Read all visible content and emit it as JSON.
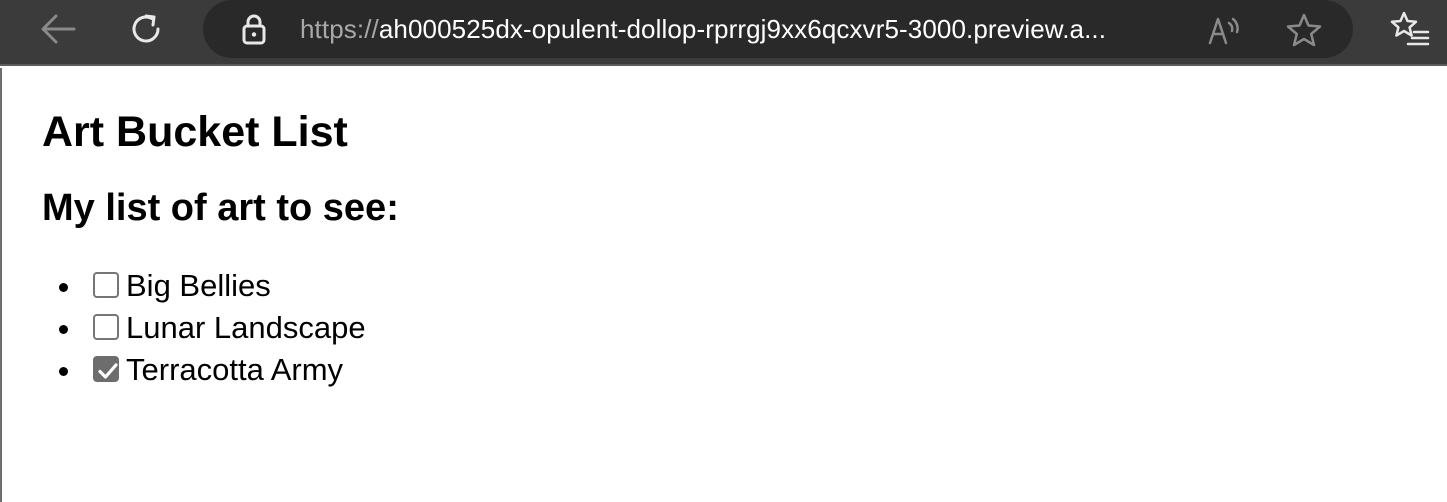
{
  "browser": {
    "url_protocol": "https://",
    "url_rest": "ah000525dx-opulent-dollop-rprrgj9xx6qcxvr5-3000.preview.a...",
    "icons": {
      "back": "arrow-left-icon",
      "reload": "reload-icon",
      "lock": "lock-icon",
      "read_aloud": "read-aloud-icon",
      "favorite": "star-icon",
      "favorites": "favorites-list-icon"
    }
  },
  "page": {
    "title": "Art Bucket List",
    "subtitle": "My list of art to see:",
    "items": [
      {
        "label": "Big Bellies",
        "checked": false
      },
      {
        "label": "Lunar Landscape",
        "checked": false
      },
      {
        "label": "Terracotta Army",
        "checked": true
      }
    ]
  }
}
